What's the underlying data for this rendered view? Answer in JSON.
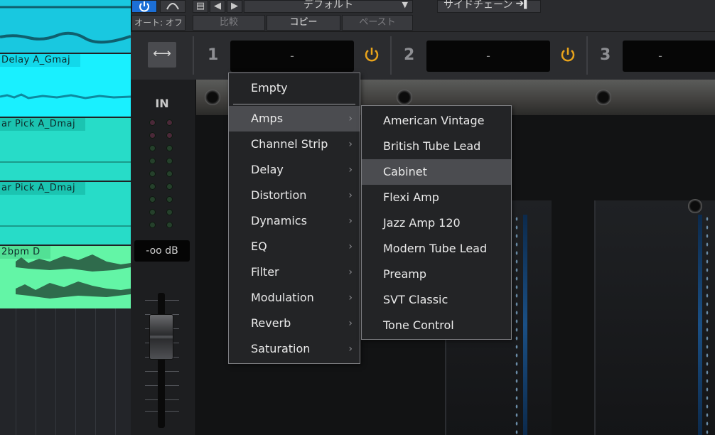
{
  "tracks": {
    "lanes": [
      {
        "label": "Delay A_Gmaj"
      },
      {
        "label": "ar Pick A_Dmaj"
      },
      {
        "label": "ar Pick A_Dmaj"
      },
      {
        "label": "2bpm D"
      }
    ]
  },
  "toolbar": {
    "auto_off": "オート: オフ",
    "preset": "デフォルト",
    "compare": "比較",
    "copy": "コピー",
    "paste": "ペースト",
    "sidechain": "サイドチェーン"
  },
  "slots": [
    {
      "number": "1",
      "value": "-"
    },
    {
      "number": "2",
      "value": "-"
    },
    {
      "number": "3",
      "value": "-"
    }
  ],
  "input": {
    "label": "IN",
    "level": "-oo dB"
  },
  "menu_main": {
    "empty": "Empty",
    "items": [
      {
        "label": "Amps"
      },
      {
        "label": "Channel Strip"
      },
      {
        "label": "Delay"
      },
      {
        "label": "Distortion"
      },
      {
        "label": "Dynamics"
      },
      {
        "label": "EQ"
      },
      {
        "label": "Filter"
      },
      {
        "label": "Modulation"
      },
      {
        "label": "Reverb"
      },
      {
        "label": "Saturation"
      }
    ],
    "highlighted": "Amps"
  },
  "menu_sub": {
    "items": [
      {
        "label": "American Vintage"
      },
      {
        "label": "British Tube Lead"
      },
      {
        "label": "Cabinet"
      },
      {
        "label": "Flexi Amp"
      },
      {
        "label": "Jazz Amp 120"
      },
      {
        "label": "Modern Tube Lead"
      },
      {
        "label": "Preamp"
      },
      {
        "label": "SVT Classic"
      },
      {
        "label": "Tone Control"
      }
    ],
    "highlighted": "Cabinet"
  },
  "colors": {
    "power_on": "#e8a31b",
    "power_btn": "#1c6fd6",
    "menu_highlight": "#4b4c50"
  }
}
